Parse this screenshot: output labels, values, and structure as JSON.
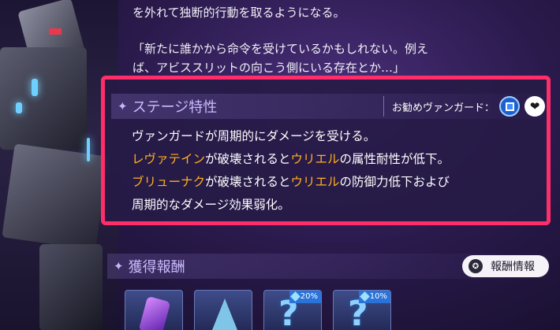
{
  "story": {
    "line1": "を外れて独断的行動を取るようになる。",
    "line2": "「新たに誰かから命令を受けているかもしれない。例え",
    "line3": "ば、アビススリットの向こう側にいる存在とか…」"
  },
  "stage": {
    "title": "ステージ特性",
    "recommended_label": "お勧めヴァンガード：",
    "recommended_icons": [
      "defender-class-icon",
      "support-heart-icon"
    ],
    "desc": {
      "line1": "ヴァンガードが周期的にダメージを受ける。",
      "line2_hl1": "レヴァテイン",
      "line2_mid": "が破壊されると",
      "line2_hl2": "ウリエル",
      "line2_end": "の属性耐性が低下。",
      "line3_hl1": "ブリューナク",
      "line3_mid": "が破壊されると",
      "line3_hl2": "ウリエル",
      "line3_end": "の防御力低下および",
      "line4": "周期的なダメージ効果弱化。"
    },
    "highlight_color": "#ffb01f",
    "border_color": "#ff2d6a"
  },
  "rewards": {
    "title": "獲得報酬",
    "info_button": "報酬情報",
    "items": [
      {
        "icon": "purple-gem-icon",
        "badge": ""
      },
      {
        "icon": "blue-crystal-icon",
        "badge": ""
      },
      {
        "icon": "question-mark-icon",
        "badge": "20%"
      },
      {
        "icon": "question-mark-icon",
        "badge": "10%"
      }
    ]
  }
}
